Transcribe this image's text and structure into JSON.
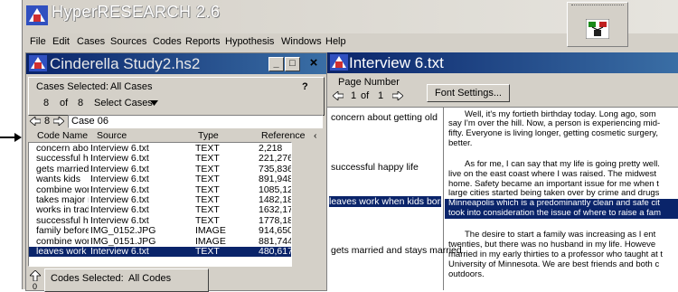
{
  "app": {
    "title": "HyperRESEARCH 2.6",
    "menu": [
      "File",
      "Edit",
      "Cases",
      "Sources",
      "Codes",
      "Reports",
      "Hypothesis",
      "Windows",
      "Help"
    ]
  },
  "left_window": {
    "title": "Cinderella Study2.hs2",
    "help_label": "?",
    "cases_selected_label": "Cases Selected:",
    "cases_selected_value": "All Cases",
    "case_index": "8",
    "case_of": "of",
    "case_total": "8",
    "select_cases_label": "Select Cases",
    "case_name": "Case 06",
    "columns": [
      "Code Name",
      "Source",
      "Type",
      "Reference"
    ],
    "rows": [
      {
        "code": "concern abou",
        "source": "Interview 6.txt",
        "type": "TEXT",
        "ref": "2,218"
      },
      {
        "code": "successful ha",
        "source": "Interview 6.txt",
        "type": "TEXT",
        "ref": "221,276"
      },
      {
        "code": "gets married a",
        "source": "Interview 6.txt",
        "type": "TEXT",
        "ref": "735,836"
      },
      {
        "code": "wants kids",
        "source": "Interview 6.txt",
        "type": "TEXT",
        "ref": "891,948"
      },
      {
        "code": "combine worl",
        "source": "Interview 6.txt",
        "type": "TEXT",
        "ref": "1085,1204"
      },
      {
        "code": "takes major r",
        "source": "Interview 6.txt",
        "type": "TEXT",
        "ref": "1482,1871"
      },
      {
        "code": "works in tradi",
        "source": "Interview 6.txt",
        "type": "TEXT",
        "ref": "1632,1775"
      },
      {
        "code": "successful ha",
        "source": "Interview 6.txt",
        "type": "TEXT",
        "ref": "1778,1871"
      },
      {
        "code": "family before",
        "source": "IMG_0152.JPG",
        "type": "IMAGE",
        "ref": "914,650,114"
      },
      {
        "code": "combine worl",
        "source": "IMG_0151.JPG",
        "type": "IMAGE",
        "ref": "881,744,121"
      },
      {
        "code": "leaves work ¢",
        "source": "Interview 6.txt",
        "type": "TEXT",
        "ref": "480,617"
      }
    ],
    "codes_selected_label": "Codes Selected:",
    "codes_selected_value": "All Codes",
    "codes_counter": "0"
  },
  "right_window": {
    "title": "Interview 6.txt",
    "page_number_label": "Page Number",
    "page_index": "1",
    "page_of": "of",
    "page_total": "1",
    "font_settings_label": "Font Settings...",
    "codes": [
      "concern about getting old",
      "successful happy life",
      "leaves work when kids born dc",
      "gets married and stays married"
    ],
    "text_lines": [
      "Well, it's my fortieth birthday today.  Long ago, som",
      "say I'm over the hill.  Now, a person is experiencing mid-",
      "fifty.  Everyone is living longer, getting cosmetic surgery,",
      "better.",
      "",
      "As for me, I can say that my life is going pretty well.",
      "live on the east coast where I was raised.  The midwest",
      "home.  Safety became an important issue for me when t",
      "large cities started being taken over by crime and drugs",
      "Minneapolis which is a predominantly clean and safe cit",
      "took into consideration the issue of where to raise a fam",
      "",
      "The desire to start a family was increasing as  I ent",
      "twenties, but there was no husband in my life.  Howeve",
      "married in my early thirties to a professor who taught at t",
      "University of Minnesota.  We are best friends and both c",
      "outdoors."
    ]
  }
}
